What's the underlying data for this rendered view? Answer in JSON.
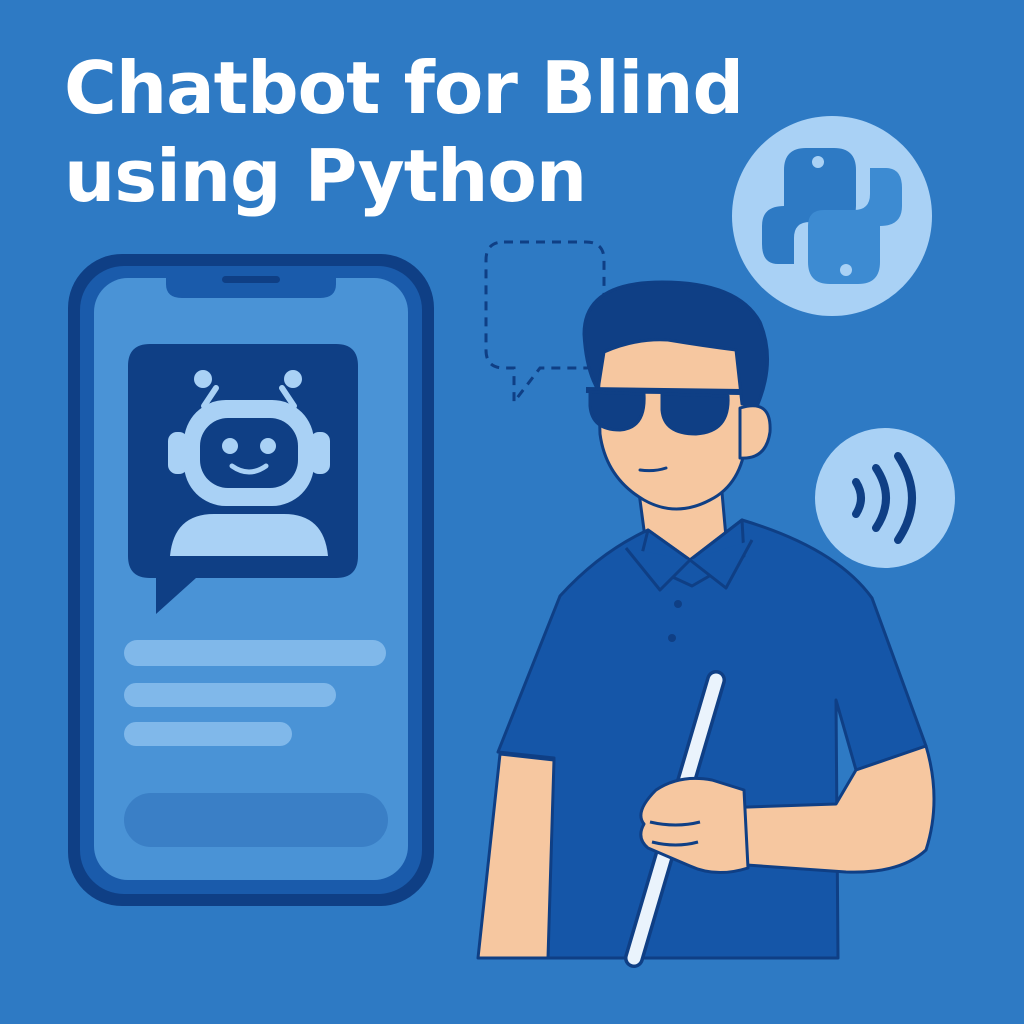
{
  "title": {
    "line1": "Chatbot for Blind",
    "line2": "using Python"
  },
  "colors": {
    "background": "#2e7ac4",
    "dark_blue": "#0f3f85",
    "phone_frame": "#1a5bab",
    "phone_screen": "#4a93d6",
    "light_blue": "#a9d1f5",
    "skin": "#f6c7a0",
    "shirt": "#1556a8",
    "cane": "#eaf3fc"
  },
  "icons": [
    "phone-icon",
    "robot-icon",
    "python-logo-icon",
    "sound-wave-icon",
    "speech-bubble-icon"
  ]
}
